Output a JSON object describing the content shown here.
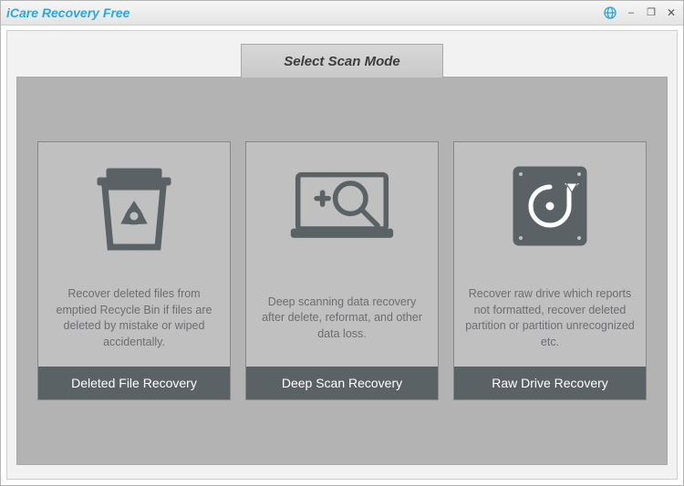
{
  "app_title": "iCare Recovery Free",
  "tab_label": "Select Scan Mode",
  "cards": [
    {
      "icon": "recycle-bin-icon",
      "desc": "Recover deleted files from emptied Recycle Bin if files are deleted by mistake or wiped accidentally.",
      "button": "Deleted File Recovery"
    },
    {
      "icon": "deep-scan-icon",
      "desc": "Deep scanning data recovery after delete, reformat, and other data loss.",
      "button": "Deep Scan Recovery"
    },
    {
      "icon": "raw-drive-icon",
      "desc": "Recover raw drive which reports not formatted, recover deleted partition or partition unrecognized etc.",
      "button": "Raw Drive Recovery"
    }
  ],
  "window_controls": {
    "minimize": "–",
    "restore": "❐",
    "close": "✕"
  }
}
